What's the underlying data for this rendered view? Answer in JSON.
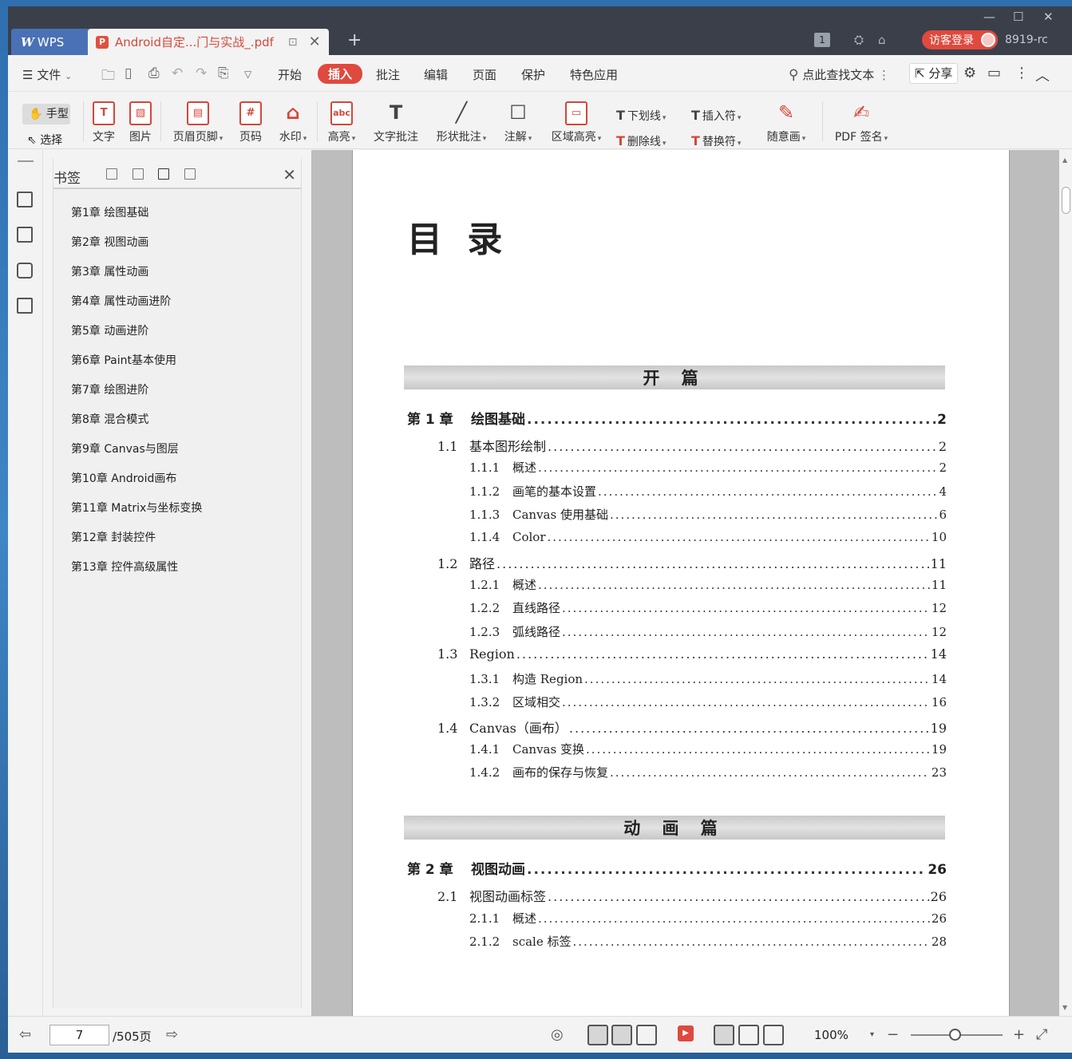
{
  "titlebar": {
    "app_tab": "WPS",
    "doc_tab": "Android自定...门与实战_.pdf",
    "page_badge": "1",
    "login_label": "访客登录",
    "user_id": "8919-rc"
  },
  "menu": {
    "file": "文件",
    "items": [
      "开始",
      "插入",
      "批注",
      "编辑",
      "页面",
      "保护",
      "特色应用"
    ],
    "active": "插入",
    "search_label": "点此查找文本",
    "share_label": "分享"
  },
  "toolbar": {
    "hand": "手型",
    "select": "选择",
    "tools": [
      "文字",
      "图片",
      "页眉页脚",
      "页码",
      "水印",
      "高亮",
      "文字批注",
      "形状批注",
      "注解",
      "区域高亮"
    ],
    "underline": "下划线",
    "strikethrough": "删除线",
    "insert_mark": "插入符",
    "replace_mark": "替换符",
    "freehand": "随意画",
    "pdf_sign": "PDF 签名"
  },
  "bookmarks": {
    "title": "书签",
    "items": [
      "第1章 绘图基础",
      "第2章 视图动画",
      "第3章 属性动画",
      "第4章 属性动画进阶",
      "第5章 动画进阶",
      "第6章 Paint基本使用",
      "第7章 绘图进阶",
      "第8章 混合模式",
      "第9章 Canvas与图层",
      "第10章 Android画布",
      "第11章 Matrix与坐标变换",
      "第12章 封装控件",
      "第13章 控件高级属性"
    ]
  },
  "page": {
    "title": "目 录",
    "part1": "开 篇",
    "part2": "动 画 篇",
    "toc1": [
      {
        "level": 1,
        "num": "第 1 章",
        "title": "绘图基础",
        "page": "2"
      },
      {
        "level": 2,
        "num": "1.1",
        "title": "基本图形绘制",
        "page": "2"
      },
      {
        "level": 3,
        "num": "1.1.1",
        "title": "概述",
        "page": "2"
      },
      {
        "level": 3,
        "num": "1.1.2",
        "title": "画笔的基本设置",
        "page": "4"
      },
      {
        "level": 3,
        "num": "1.1.3",
        "title": "Canvas 使用基础",
        "page": "6"
      },
      {
        "level": 3,
        "num": "1.1.4",
        "title": "Color",
        "page": "10"
      },
      {
        "level": 2,
        "num": "1.2",
        "title": "路径",
        "page": "11"
      },
      {
        "level": 3,
        "num": "1.2.1",
        "title": "概述",
        "page": "11"
      },
      {
        "level": 3,
        "num": "1.2.2",
        "title": "直线路径",
        "page": "12"
      },
      {
        "level": 3,
        "num": "1.2.3",
        "title": "弧线路径",
        "page": "12"
      },
      {
        "level": 2,
        "num": "1.3",
        "title": "Region",
        "page": "14"
      },
      {
        "level": 3,
        "num": "1.3.1",
        "title": "构造 Region",
        "page": "14"
      },
      {
        "level": 3,
        "num": "1.3.2",
        "title": "区域相交",
        "page": "16"
      },
      {
        "level": 2,
        "num": "1.4",
        "title": "Canvas（画布）",
        "page": "19"
      },
      {
        "level": 3,
        "num": "1.4.1",
        "title": "Canvas 变换",
        "page": "19"
      },
      {
        "level": 3,
        "num": "1.4.2",
        "title": "画布的保存与恢复",
        "page": "23"
      }
    ],
    "toc2": [
      {
        "level": 1,
        "num": "第 2 章",
        "title": "视图动画",
        "page": "26"
      },
      {
        "level": 2,
        "num": "2.1",
        "title": "视图动画标签",
        "page": "26"
      },
      {
        "level": 3,
        "num": "2.1.1",
        "title": "概述",
        "page": "26"
      },
      {
        "level": 3,
        "num": "2.1.2",
        "title": "scale 标签",
        "page": "28"
      }
    ]
  },
  "status": {
    "current_page": "7",
    "total_pages": "/505页",
    "zoom": "100%"
  },
  "colors": {
    "accent": "#e0493e",
    "titlebar": "#3b3f4a",
    "wps_tab": "#4a71b5"
  }
}
